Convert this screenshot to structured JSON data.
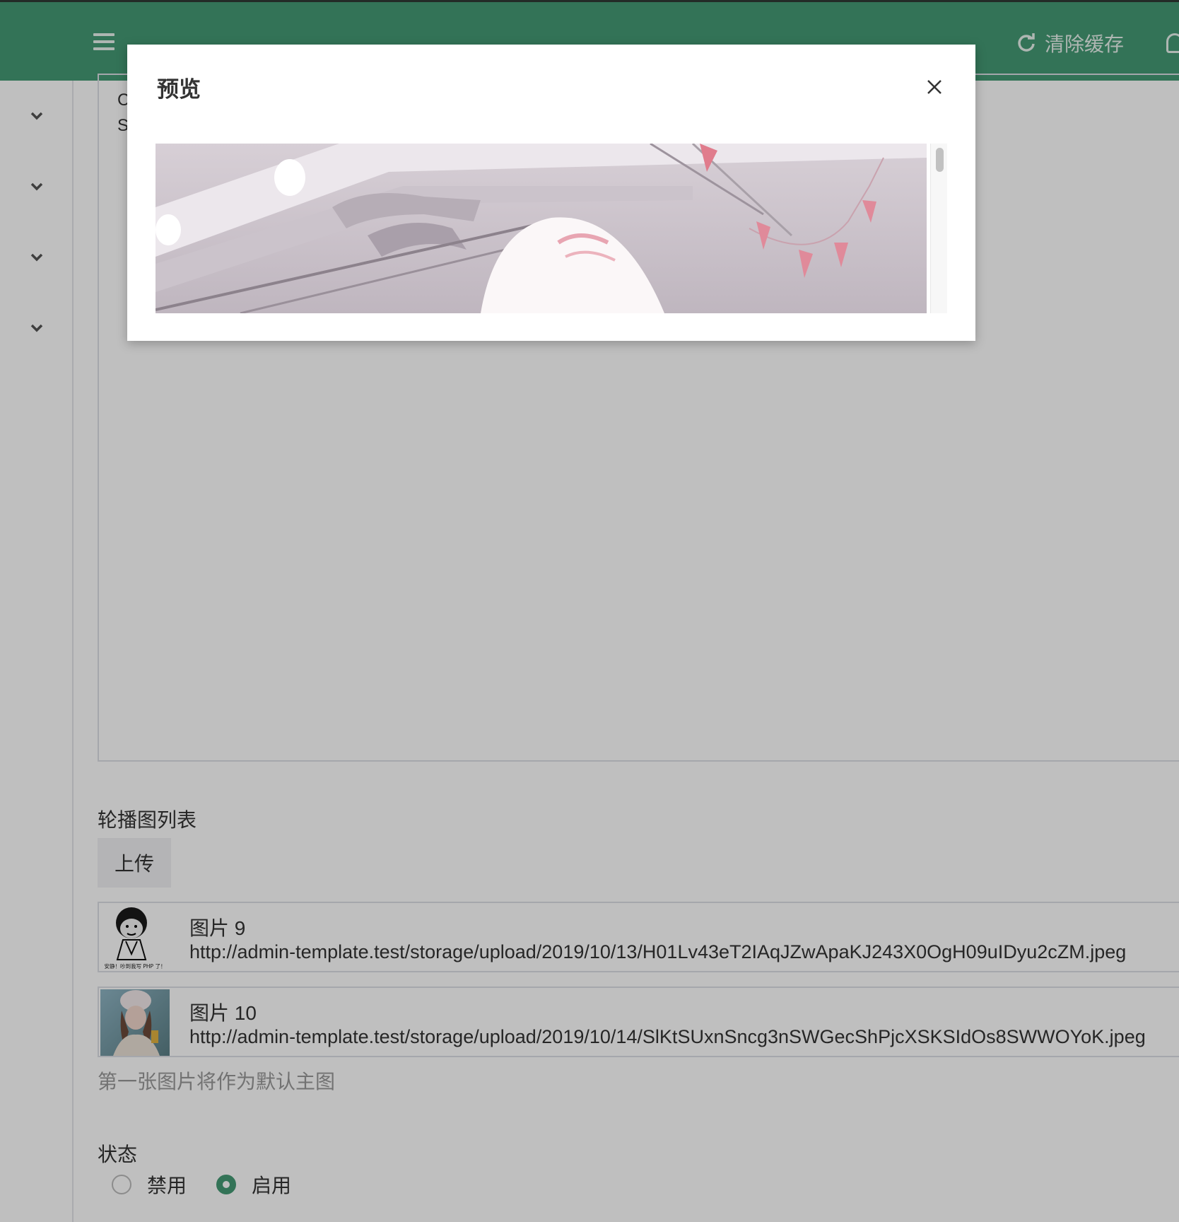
{
  "header": {
    "clear_cache_label": "清除缓存"
  },
  "editor": {
    "line1": "C",
    "line2": "S"
  },
  "carousel": {
    "label": "轮播图列表",
    "upload_label": "上传",
    "items": [
      {
        "name": "图片 9",
        "url": "http://admin-template.test/storage/upload/2019/10/13/H01Lv43eT2IAqJZwApaKJ243X0OgH09uIDyu2cZM.jpeg",
        "thumb_caption": "安静！吵到我写 PHP 了！"
      },
      {
        "name": "图片 10",
        "url": "http://admin-template.test/storage/upload/2019/10/14/SlKtSUxnSncg3nSWGecShPjcXSKSIdOs8SWWOYoK.jpeg"
      }
    ],
    "hint": "第一张图片将作为默认主图"
  },
  "status": {
    "label": "状态",
    "options": [
      {
        "label": "禁用",
        "checked": false
      },
      {
        "label": "启用",
        "checked": true
      }
    ]
  },
  "modal": {
    "title": "预览"
  },
  "colors": {
    "brand": "#459a74",
    "overlay": "rgba(0,0,0,0.25)"
  },
  "icons": {
    "menu": "hamburger-icon",
    "refresh": "refresh-icon",
    "user": "user-icon",
    "chevron": "chevron-down-icon",
    "close": "close-icon"
  }
}
